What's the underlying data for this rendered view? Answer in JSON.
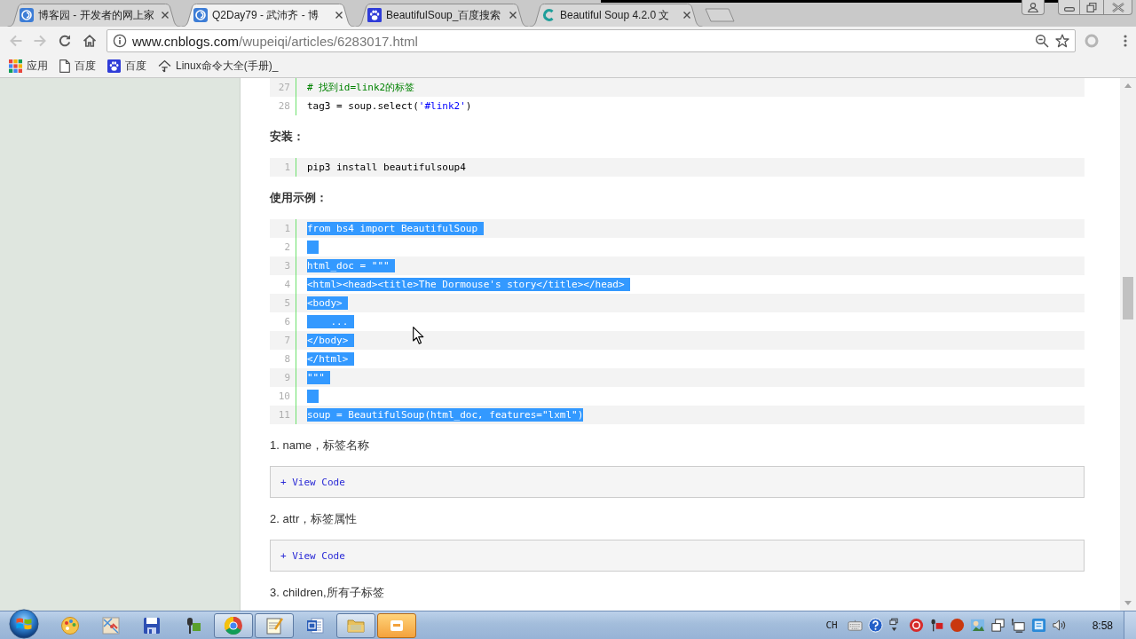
{
  "browser": {
    "tabs": [
      {
        "title": "博客园 - 开发者的网上家",
        "selected": false
      },
      {
        "title": "Q2Day79 - 武沛齐 - 博",
        "selected": true
      },
      {
        "title": "BeautifulSoup_百度搜索",
        "selected": false
      },
      {
        "title": "Beautiful Soup 4.2.0 文",
        "selected": false
      }
    ],
    "toolbar": {
      "back": {
        "disabled": true
      },
      "forward": {
        "disabled": true
      }
    },
    "address_bar": {
      "host": "www.cnblogs.com",
      "path": "/wupeiqi/articles/6283017.html"
    },
    "bookmarks": [
      {
        "label": "应用"
      },
      {
        "label": "百度"
      },
      {
        "label": "百度"
      },
      {
        "label": "Linux命令大全(手册)_"
      }
    ]
  },
  "page": {
    "blocks": [
      {
        "kind": "code",
        "lines": [
          {
            "number": "27",
            "selected": false,
            "segments": [
              {
                "kind": "comment",
                "text": "# 找到id=link2的标签"
              }
            ]
          },
          {
            "number": "28",
            "selected": false,
            "segments": [
              {
                "kind": "plain",
                "text": "tag3 = soup.select("
              },
              {
                "kind": "string",
                "text": "'#link2'"
              },
              {
                "kind": "plain",
                "text": ")"
              }
            ]
          }
        ]
      },
      {
        "kind": "heading",
        "text": "安装："
      },
      {
        "kind": "code",
        "lines": [
          {
            "number": "1",
            "selected": false,
            "segments": [
              {
                "kind": "plain",
                "text": "pip3 install beautifulsoup4"
              }
            ]
          }
        ]
      },
      {
        "kind": "heading",
        "text": "使用示例："
      },
      {
        "kind": "code",
        "lines": [
          {
            "number": "1",
            "selected": true,
            "segments": [
              {
                "kind": "plain",
                "text": "from bs4 import BeautifulSoup"
              }
            ]
          },
          {
            "number": "2",
            "selected": true
          },
          {
            "number": "3",
            "selected": true,
            "segments": [
              {
                "kind": "plain",
                "text": "html_doc = \"\"\""
              }
            ]
          },
          {
            "number": "4",
            "selected": true,
            "segments": [
              {
                "kind": "plain",
                "text": "<html><head><title>The Dormouse's story</title></head>"
              }
            ]
          },
          {
            "number": "5",
            "selected": true,
            "segments": [
              {
                "kind": "plain",
                "text": "<body>"
              }
            ]
          },
          {
            "number": "6",
            "selected": true,
            "segments": [
              {
                "kind": "plain",
                "text": "    ..."
              }
            ]
          },
          {
            "number": "7",
            "selected": true,
            "segments": [
              {
                "kind": "plain",
                "text": "</body>"
              }
            ]
          },
          {
            "number": "8",
            "selected": true,
            "segments": [
              {
                "kind": "plain",
                "text": "</html>"
              }
            ]
          },
          {
            "number": "9",
            "selected": true,
            "segments": [
              {
                "kind": "plain",
                "text": "\"\"\""
              }
            ]
          },
          {
            "number": "10",
            "selected": true
          },
          {
            "number": "11",
            "selected": true,
            "segments": [
              {
                "kind": "plain",
                "text": "soup = BeautifulSoup(html_doc, features=\"lxml\")"
              }
            ]
          }
        ]
      },
      {
        "kind": "paragraph",
        "text": "1. name，标签名称"
      },
      {
        "kind": "collapsed_code",
        "label": "+ View Code"
      },
      {
        "kind": "paragraph",
        "text": "2. attr，标签属性"
      },
      {
        "kind": "collapsed_code",
        "label": "+ View Code"
      },
      {
        "kind": "paragraph",
        "text": "3. children,所有子标签"
      }
    ]
  },
  "taskbar": {
    "buttons": [
      {
        "running": false,
        "active": false
      },
      {
        "running": false,
        "active": false
      },
      {
        "running": false,
        "active": false
      },
      {
        "running": false,
        "active": false
      },
      {
        "running": true,
        "active": false
      },
      {
        "running": true,
        "active": false
      },
      {
        "running": false,
        "active": false
      },
      {
        "running": true,
        "active": false
      },
      {
        "running": true,
        "active": true
      }
    ],
    "tray": {
      "language": "CH",
      "clock": "8:58"
    }
  }
}
